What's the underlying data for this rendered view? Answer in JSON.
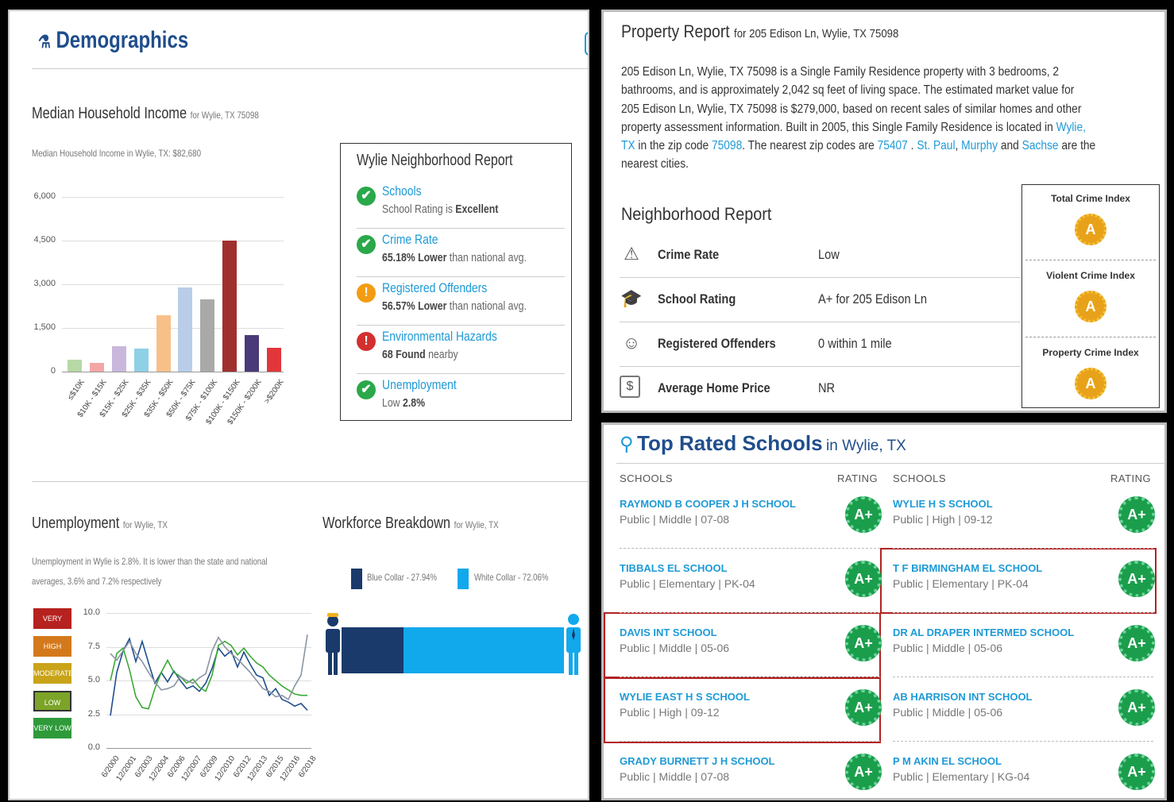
{
  "demographics": {
    "title": "Demographics",
    "income": {
      "title": "Median Household Income",
      "for": "for Wylie, TX 75098",
      "subtitle": "Median Household Income in Wylie, TX: $82,680"
    },
    "unemployment": {
      "title": "Unemployment",
      "for": "for Wylie, TX",
      "text_line1": "Unemployment in Wylie is 2.8%. It is lower than the state and national",
      "text_line2": "averages, 3.6% and 7.2% respectively",
      "levels": [
        "VERY HIGH",
        "HIGH",
        "MODERATE",
        "LOW",
        "VERY LOW"
      ]
    },
    "workforce": {
      "title": "Workforce Breakdown",
      "for": "for Wylie, TX",
      "blue_collar": "Blue Collar - 27.94%",
      "white_collar": "White Collar - 72.06%",
      "blue_collar_pct": 27.94,
      "colors": {
        "blue_collar": "#1a3a6b",
        "white_collar": "#12a9ec"
      }
    }
  },
  "neighborhood_box": {
    "title": "Wylie Neighborhood Report",
    "items": [
      {
        "label": "Schools",
        "detail_pre": "School Rating is ",
        "detail_bold": "Excellent",
        "detail_post": "",
        "status": "check"
      },
      {
        "label": "Crime Rate",
        "detail_pre": "",
        "detail_bold": "65.18% Lower",
        "detail_post": " than national avg.",
        "status": "check"
      },
      {
        "label": "Registered Offenders",
        "detail_pre": "",
        "detail_bold": "56.57% Lower",
        "detail_post": " than national avg.",
        "status": "warning"
      },
      {
        "label": "Environmental Hazards",
        "detail_pre": "",
        "detail_bold": "68 Found",
        "detail_post": " nearby",
        "status": "alert"
      },
      {
        "label": "Unemployment",
        "detail_pre": "Low ",
        "detail_bold": "2.8%",
        "detail_post": "",
        "status": "check"
      }
    ]
  },
  "property": {
    "title": "Property Report",
    "for": "for 205 Edison Ln, Wylie, TX 75098",
    "desc1": "205 Edison Ln, Wylie, TX 75098 is a Single Family Residence property with 3 bedrooms, 2",
    "desc2": "bathrooms, and is approximately 2,042 sq feet of living space. The estimated market value for",
    "desc3": "205 Edison Ln, Wylie, TX 75098 is $279,000, based on recent sales of similar homes and other",
    "desc4": "property assessment information. Built in 2005, this Single Family Residence is located in",
    "link_wylie1": "Wylie,",
    "link_wylie2": "TX",
    "desc5a": " in the zip code ",
    "link_zip": "75098",
    "desc5b": ". The nearest zip codes are ",
    "link_zip2": "75407",
    "desc5c": " . ",
    "link_stpaul": "St. Paul",
    "desc5d": ", ",
    "link_murphy": "Murphy",
    "desc5e": " and ",
    "link_sachse": "Sachse",
    "desc5f": " are the",
    "desc6": "nearest cities.",
    "report_title": "Neighborhood Report",
    "rows": [
      {
        "label": "Crime Rate",
        "value": "Low",
        "icon": "siren-icon"
      },
      {
        "label": "School Rating",
        "value": "A+ for 205 Edison Ln",
        "icon": "graduation-cap-icon"
      },
      {
        "label": "Registered Offenders",
        "value": "0 within 1 mile",
        "icon": "offender-icon"
      },
      {
        "label": "Average Home Price",
        "value": "NR",
        "icon": "home-price-icon"
      }
    ],
    "crime_indexes": [
      {
        "title": "Total Crime Index",
        "grade": "A"
      },
      {
        "title": "Violent Crime Index",
        "grade": "A"
      },
      {
        "title": "Property Crime Index",
        "grade": "A"
      }
    ]
  },
  "schools": {
    "title": "Top Rated Schools",
    "for": "in Wylie, TX",
    "col_schools": "SCHOOLS",
    "col_rating": "RATING",
    "left": [
      {
        "name": "RAYMOND B COOPER J H SCHOOL",
        "detail": "Public | Middle | 07-08",
        "rating": "A+"
      },
      {
        "name": "TIBBALS EL SCHOOL",
        "detail": "Public | Elementary | PK-04",
        "rating": "A+"
      },
      {
        "name": "DAVIS INT SCHOOL",
        "detail": "Public | Middle | 05-06",
        "rating": "A+"
      },
      {
        "name": "WYLIE EAST H S SCHOOL",
        "detail": "Public | High | 09-12",
        "rating": "A+"
      },
      {
        "name": "GRADY BURNETT J H SCHOOL",
        "detail": "Public | Middle | 07-08",
        "rating": "A+"
      }
    ],
    "right": [
      {
        "name": "WYLIE H S SCHOOL",
        "detail": "Public | High | 09-12",
        "rating": "A+"
      },
      {
        "name": "T F BIRMINGHAM EL SCHOOL",
        "detail": "Public | Elementary | PK-04",
        "rating": "A+"
      },
      {
        "name": "DR AL DRAPER INTERMED SCHOOL",
        "detail": "Public | Middle | 05-06",
        "rating": "A+"
      },
      {
        "name": "AB HARRISON INT SCHOOL",
        "detail": "Public | Middle | 05-06",
        "rating": "A+"
      },
      {
        "name": "P M AKIN EL SCHOOL",
        "detail": "Public | Elementary | KG-04",
        "rating": "A+"
      }
    ]
  },
  "chart_data": [
    {
      "type": "bar",
      "categories": [
        "≤$10K",
        "$10K - $15K",
        "$15K - $25K",
        "$25K - $35K",
        "$35K - $50K",
        "$50K - $75K",
        "$75K - $100K",
        "$100K - $150K",
        "$150K - $200K",
        ">$200K"
      ],
      "values": [
        420,
        300,
        870,
        800,
        1950,
        2900,
        2480,
        4500,
        1250,
        820
      ],
      "colors": [
        "#b7d9a5",
        "#f3a6a6",
        "#c9b8dc",
        "#8ed0e6",
        "#f7c089",
        "#b9cde8",
        "#a9a9a9",
        "#a0302e",
        "#4a3a78",
        "#e2363b"
      ],
      "yticks": [
        "6,000",
        "4,500",
        "3,000",
        "1,500",
        "0"
      ],
      "ylim": [
        0,
        6000
      ]
    },
    {
      "type": "line",
      "xticks": [
        "6/2000",
        "12/2001",
        "6/2003",
        "12/2004",
        "6/2006",
        "12/2007",
        "6/2009",
        "12/2010",
        "6/2012",
        "12/2013",
        "6/2015",
        "12/2016",
        "6/2018"
      ],
      "yticks": [
        "10.0",
        "7.5",
        "5.0",
        "2.5",
        "0.0"
      ],
      "ylim": [
        0,
        10
      ],
      "series": [
        {
          "color": "#1f4e8c",
          "values": [
            2.4,
            5.6,
            7.2,
            8.1,
            6.4,
            7.9,
            6.3,
            4.8,
            5.6,
            4.9,
            5.7,
            5.0,
            4.4,
            4.6,
            4.2,
            4.8,
            5.9,
            7.4,
            6.8,
            7.2,
            6.0,
            7.1,
            6.2,
            5.4,
            5.2,
            3.9,
            4.4,
            3.6,
            3.4,
            3.1,
            3.3,
            2.8
          ]
        },
        {
          "color": "#3aaa35",
          "values": [
            5.0,
            7.0,
            7.4,
            5.8,
            3.8,
            3.0,
            2.9,
            4.4,
            5.6,
            6.5,
            5.6,
            5.3,
            4.8,
            5.1,
            4.5,
            4.2,
            5.4,
            7.6,
            7.9,
            7.6,
            6.9,
            7.4,
            6.8,
            6.3,
            6.0,
            5.4,
            5.0,
            4.6,
            4.3,
            4.0,
            3.9,
            3.9
          ]
        },
        {
          "color": "#8b95a3",
          "values": [
            7.0,
            6.5,
            7.2,
            7.9,
            7.0,
            6.4,
            5.6,
            4.9,
            4.3,
            4.4,
            4.6,
            5.3,
            5.0,
            4.8,
            5.2,
            5.5,
            7.2,
            8.2,
            7.5,
            7.0,
            6.6,
            6.1,
            5.6,
            5.0,
            4.4,
            4.2,
            3.8,
            3.9,
            3.6,
            4.6,
            5.4,
            8.4
          ]
        }
      ]
    }
  ]
}
